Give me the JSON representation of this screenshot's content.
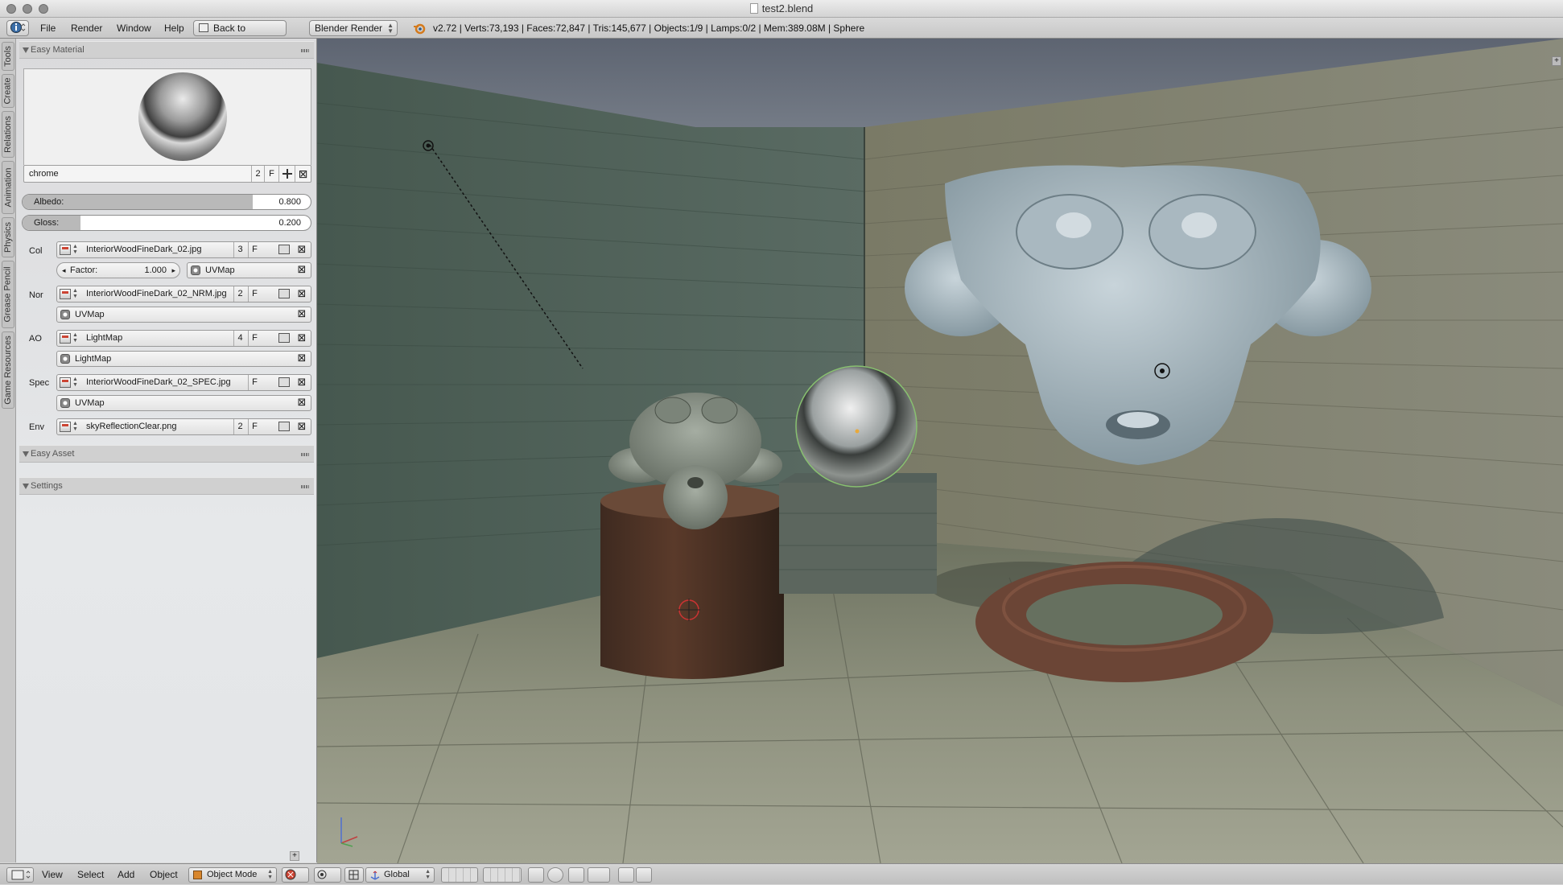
{
  "window": {
    "title": "test2.blend"
  },
  "infobar": {
    "menus": [
      "File",
      "Render",
      "Window",
      "Help"
    ],
    "back_button": "Back to Previous",
    "render_engine": "Blender Render",
    "stats": "v2.72 | Verts:73,193 | Faces:72,847 | Tris:145,677 | Objects:1/9 | Lamps:0/2 | Mem:389.08M | Sphere"
  },
  "toolshelf_tabs": [
    "Tools",
    "Create",
    "Relations",
    "Animation",
    "Physics",
    "Grease Pencil",
    "Game Resources"
  ],
  "easy_material": {
    "header": "Easy Material",
    "material_name": "chrome",
    "material_users": "2",
    "fake_user": "F",
    "albedo": {
      "label": "Albedo:",
      "value": "0.800",
      "fraction": 0.8
    },
    "gloss": {
      "label": "Gloss:",
      "value": "0.200",
      "fraction": 0.2
    },
    "col": {
      "label": "Col",
      "texture": "InteriorWoodFineDark_02.jpg",
      "users": "3",
      "fake": "F",
      "factor_label": "Factor:",
      "factor_value": "1.000",
      "uvmap": "UVMap"
    },
    "nor": {
      "label": "Nor",
      "texture": "InteriorWoodFineDark_02_NRM.jpg",
      "users": "2",
      "fake": "F",
      "uvmap": "UVMap"
    },
    "ao": {
      "label": "AO",
      "texture": "LightMap",
      "users": "4",
      "fake": "F",
      "uvmap": "LightMap"
    },
    "spec": {
      "label": "Spec",
      "texture": "InteriorWoodFineDark_02_SPEC.jpg",
      "fake": "F",
      "uvmap": "UVMap"
    },
    "env": {
      "label": "Env",
      "texture": "skyReflectionClear.png",
      "users": "2",
      "fake": "F"
    }
  },
  "easy_asset": {
    "header": "Easy Asset"
  },
  "settings": {
    "header": "Settings"
  },
  "bottombar": {
    "menus": [
      "View",
      "Select",
      "Add",
      "Object"
    ],
    "mode": "Object Mode",
    "orientation": "Global"
  }
}
